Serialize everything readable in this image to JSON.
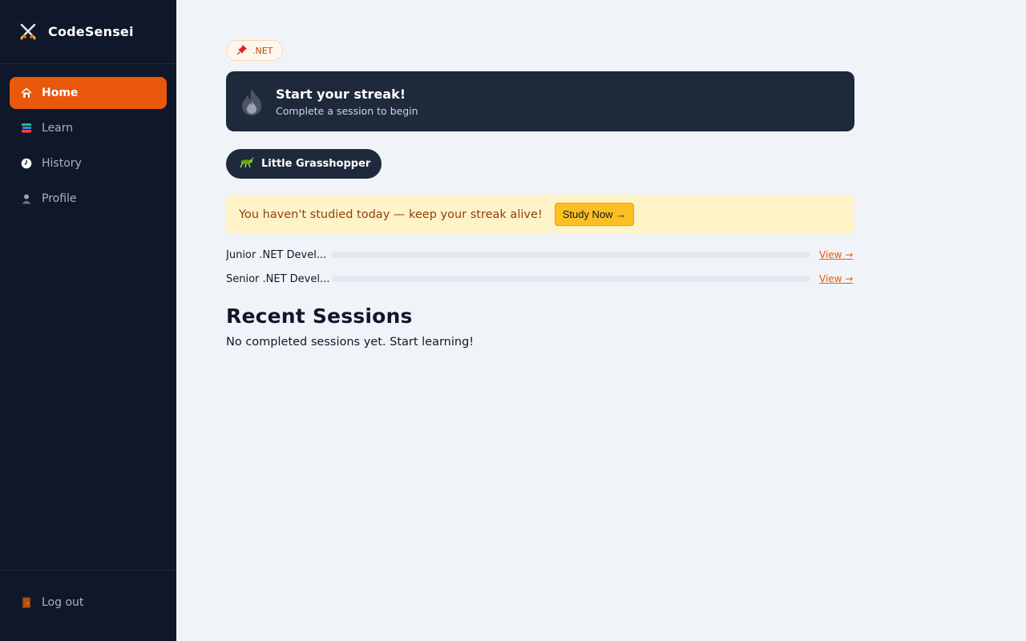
{
  "app": {
    "name": "CodeSensei",
    "logo_icon": "crossed-swords-icon"
  },
  "sidebar": {
    "items": [
      {
        "label": "Home",
        "icon": "house-icon",
        "active": true
      },
      {
        "label": "Learn",
        "icon": "books-icon",
        "active": false
      },
      {
        "label": "History",
        "icon": "clock-icon",
        "active": false
      },
      {
        "label": "Profile",
        "icon": "person-icon",
        "active": false
      }
    ],
    "logout": {
      "label": "Log out",
      "icon": "door-icon"
    }
  },
  "main": {
    "tag": {
      "label": ".NET",
      "icon": "pushpin-icon"
    },
    "streak": {
      "title": "Start your streak!",
      "subtitle": "Complete a session to begin",
      "icon": "flame-icon"
    },
    "rank": {
      "label": "Little Grasshopper",
      "icon": "grasshopper-icon"
    },
    "banner": {
      "text": "You haven't studied today — keep your streak alive!",
      "button": "Study Now →"
    },
    "tracks": [
      {
        "name": "Junior .NET Devel...",
        "progress": 0,
        "link": "View →"
      },
      {
        "name": "Senior .NET Devel...",
        "progress": 0,
        "link": "View →"
      }
    ],
    "recent": {
      "title": "Recent Sessions",
      "empty": "No completed sessions yet. Start learning!"
    }
  },
  "colors": {
    "accent": "#ea580c",
    "sidebar_bg": "#0f172a",
    "card_bg": "#1e293b",
    "banner_bg": "#fef3c7",
    "button_bg": "#fbbf24"
  }
}
